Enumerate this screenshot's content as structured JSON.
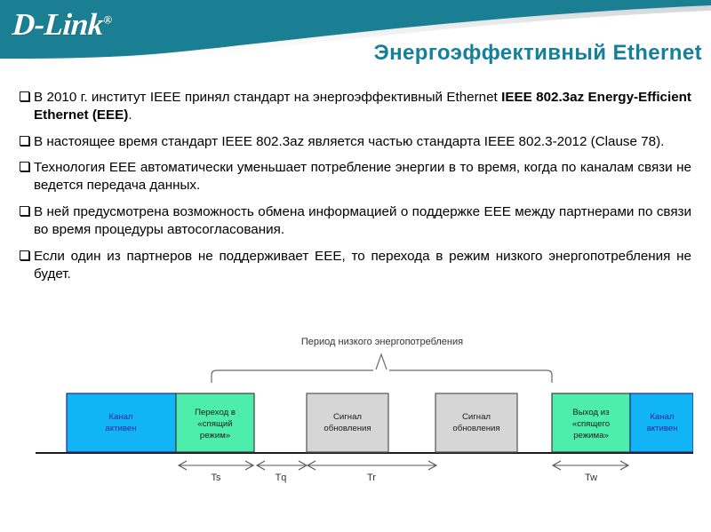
{
  "header": {
    "logo_text": "D-Link",
    "logo_registered": "®",
    "title": "Энергоэффективный Ethernet",
    "brand_color": "#14809b",
    "title_color": "#14809b"
  },
  "content": {
    "bullets": [
      {
        "marker": "white-square-bullet",
        "text_plain": "В 2010 г. институт IEEE принял стандарт на энергоэффективный Ethernet IEEE 802.3az Energy-Efficient Ethernet (EEE).",
        "lead": "В 2010 г. институт IEEE принял стандарт на энергоэффективный Ethernet ",
        "bold": "IEEE 802.3az Energy-Efficient Ethernet (EEE)",
        "tail": "."
      },
      {
        "marker": "white-square-bullet",
        "text_plain": "В настоящее время стандарт IEEE 802.3az является частью стандарта IEEE 802.3-2012 (Clause 78).",
        "lead": "В настоящее время стандарт IEEE 802.3az является частью стандарта IEEE 802.3-2012 (Clause 78).",
        "bold": "",
        "tail": ""
      },
      {
        "marker": "white-square-bullet",
        "text_plain": "Технология EEE автоматически уменьшает потребление энергии в то время, когда по каналам связи не ведется передача данных.",
        "lead": "Технология EEE автоматически уменьшает потребление энергии в то время, когда по каналам связи не ведется передача данных.",
        "bold": "",
        "tail": ""
      },
      {
        "marker": "white-square-bullet",
        "text_plain": "В ней предусмотрена возможность обмена информацией о поддержке EEE между партнерами по связи во время процедуры автосогласования.",
        "lead": "В ней предусмотрена возможность обмена информацией о поддержке EEE между партнерами по связи во время процедуры автосогласования.",
        "bold": "",
        "tail": ""
      },
      {
        "marker": "white-square-bullet",
        "text_plain": "Если один из партнеров не поддерживает EEE, то перехода в режим низкого энергопотребления не будет.",
        "lead": "Если один из партнеров не поддерживает EEE, то перехода в режим низкого энергопотребления не будет.",
        "bold": "",
        "tail": ""
      }
    ]
  },
  "diagram": {
    "caption": "Период низкого энергопотребления",
    "blocks": [
      {
        "label": "Канал активен",
        "line1": "Канал",
        "line2": "активен",
        "line3": "",
        "color": "#11b5f5",
        "kind": "active-link"
      },
      {
        "label": "Переход в «спящий режим»",
        "line1": "Переход в",
        "line2": "«спящий",
        "line3": "режим»",
        "color": "#4deeab",
        "kind": "enter-sleep"
      },
      {
        "label": "Сигнал обновления",
        "line1": "Сигнал",
        "line2": "обновления",
        "line3": "",
        "color": "#d6d6d6",
        "kind": "refresh-signal"
      },
      {
        "label": "Сигнал обновления",
        "line1": "Сигнал",
        "line2": "обновления",
        "line3": "",
        "color": "#d6d6d6",
        "kind": "refresh-signal"
      },
      {
        "label": "Выход из «спящего режима»",
        "line1": "Выход из",
        "line2": "«спящего",
        "line3": "режима»",
        "color": "#4deeab",
        "kind": "exit-sleep"
      },
      {
        "label": "Канал активен",
        "line1": "Канал",
        "line2": "активен",
        "line3": "",
        "color": "#11b5f5",
        "kind": "active-link"
      }
    ],
    "intervals": [
      {
        "name": "Ts"
      },
      {
        "name": "Tq"
      },
      {
        "name": "Tr"
      },
      {
        "name": "Tw"
      }
    ]
  }
}
